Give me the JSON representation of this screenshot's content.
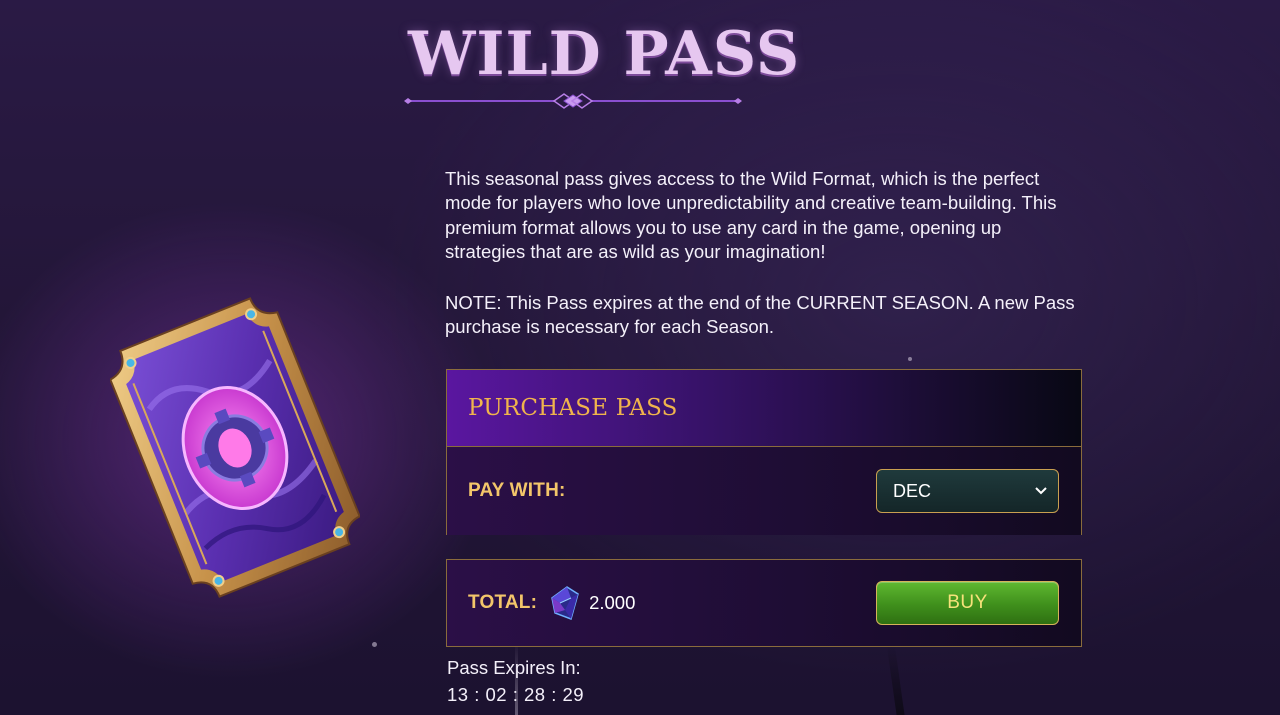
{
  "page": {
    "title": "WILD PASS"
  },
  "description": {
    "line1": "This seasonal pass gives access to the Wild Format, which is the perfect mode for players who love unpredictability and creative team-building. This premium format allows you to use any card in the game, opening up strategies that are as wild as your imagination!",
    "note": "NOTE: This Pass expires at the end of the CURRENT SEASON. A new Pass purchase is necessary for each Season."
  },
  "purchase": {
    "header": "PURCHASE PASS",
    "pay_with_label": "PAY WITH:",
    "pay_with_value": "DEC",
    "total_label": "TOTAL:",
    "total_value": "2.000",
    "currency_icon": "crystal-gem-icon",
    "buy_label": "BUY"
  },
  "expiry": {
    "label": "Pass Expires In:",
    "countdown": "13 : 02 : 28 : 29"
  },
  "colors": {
    "accent_gold": "#f0b44c",
    "label_gold": "#f3c66a",
    "buy_green": "#4fa323",
    "title_pink": "#e6c7f0",
    "panel_border": "#8a6c3c"
  }
}
